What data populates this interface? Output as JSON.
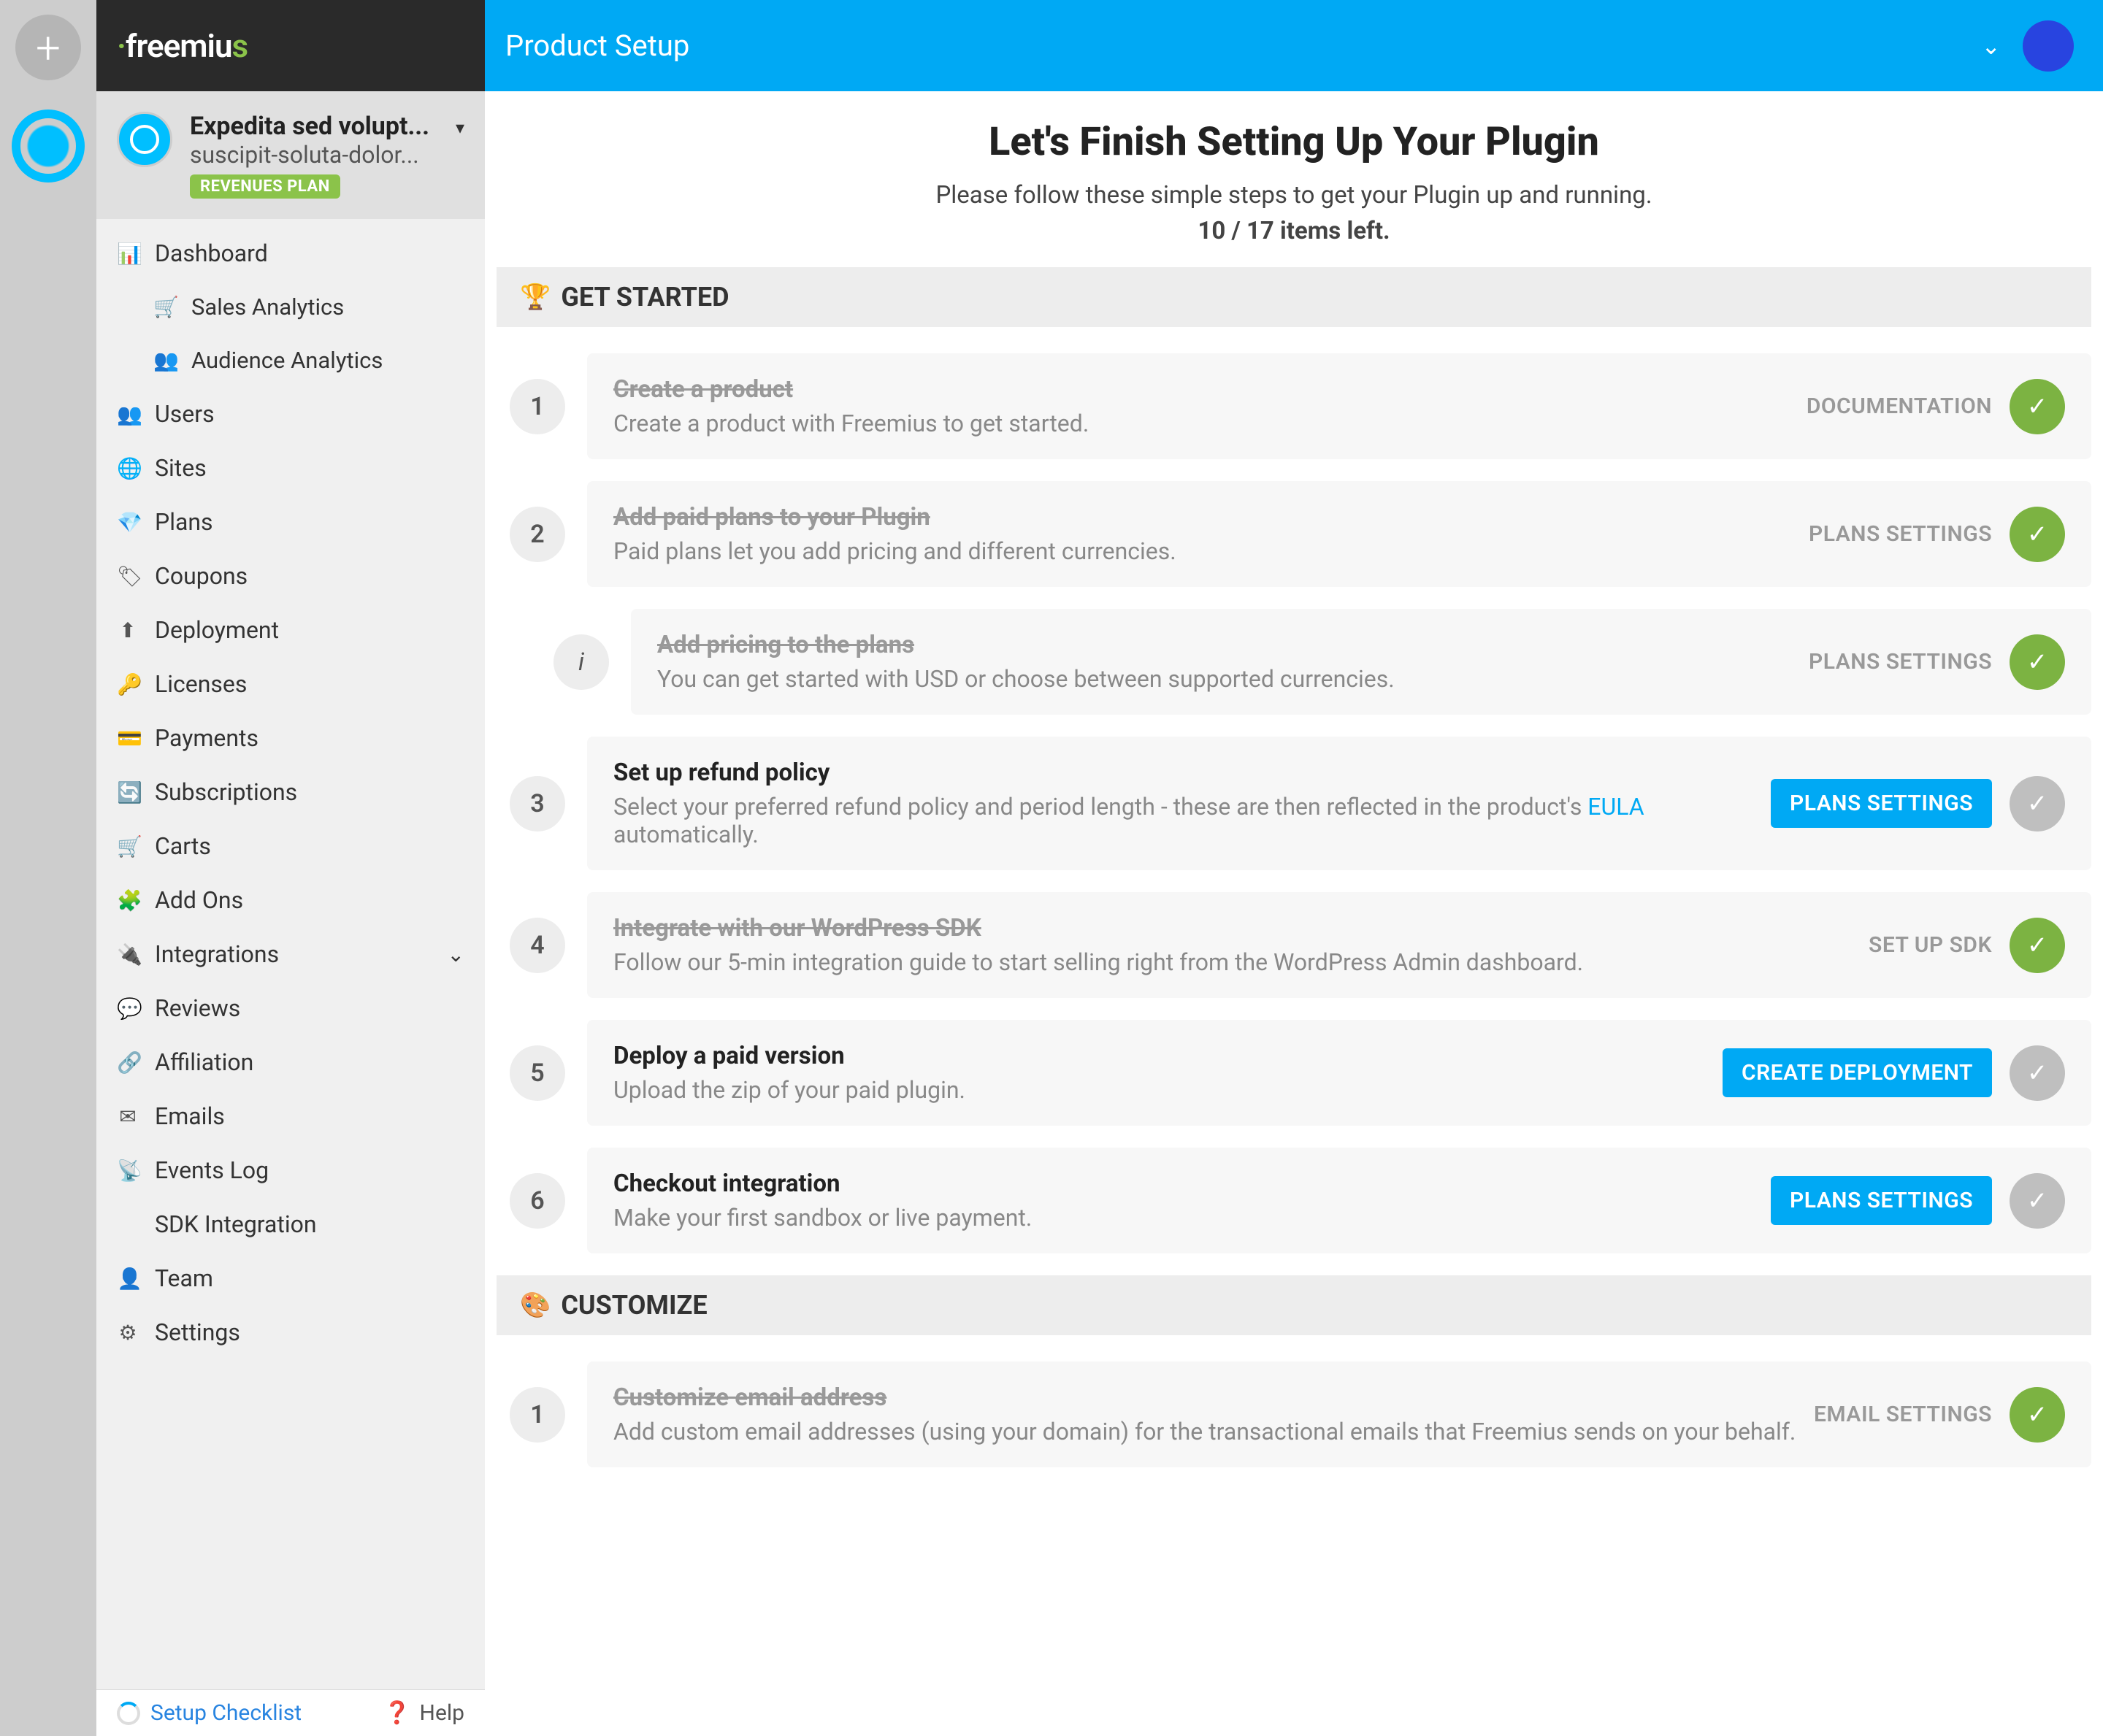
{
  "brand": {
    "name": "freemius"
  },
  "header": {
    "title": "Product Setup"
  },
  "product": {
    "title": "Expedita sed volupt...",
    "subtitle": "suscipit-soluta-dolor...",
    "badge": "REVENUES PLAN"
  },
  "nav": [
    {
      "label": "Dashboard",
      "icon": "📊",
      "name": "dashboard"
    },
    {
      "label": "Sales Analytics",
      "icon": "🛒",
      "name": "sales-analytics",
      "sub": true
    },
    {
      "label": "Audience Analytics",
      "icon": "👥",
      "name": "audience-analytics",
      "sub": true
    },
    {
      "label": "Users",
      "icon": "👥",
      "name": "users"
    },
    {
      "label": "Sites",
      "icon": "🌐",
      "name": "sites"
    },
    {
      "label": "Plans",
      "icon": "💎",
      "name": "plans"
    },
    {
      "label": "Coupons",
      "icon": "🏷",
      "name": "coupons"
    },
    {
      "label": "Deployment",
      "icon": "⬆",
      "name": "deployment"
    },
    {
      "label": "Licenses",
      "icon": "🔑",
      "name": "licenses"
    },
    {
      "label": "Payments",
      "icon": "💳",
      "name": "payments"
    },
    {
      "label": "Subscriptions",
      "icon": "🔄",
      "name": "subscriptions"
    },
    {
      "label": "Carts",
      "icon": "🛒",
      "name": "carts"
    },
    {
      "label": "Add Ons",
      "icon": "🧩",
      "name": "addons"
    },
    {
      "label": "Integrations",
      "icon": "🔌",
      "name": "integrations",
      "expand": true
    },
    {
      "label": "Reviews",
      "icon": "💬",
      "name": "reviews"
    },
    {
      "label": "Affiliation",
      "icon": "🔗",
      "name": "affiliation"
    },
    {
      "label": "Emails",
      "icon": "✉",
      "name": "emails"
    },
    {
      "label": "Events Log",
      "icon": "📡",
      "name": "events-log"
    },
    {
      "label": "SDK Integration",
      "icon": "</>",
      "name": "sdk-integration"
    },
    {
      "label": "Team",
      "icon": "👤",
      "name": "team"
    },
    {
      "label": "Settings",
      "icon": "⚙",
      "name": "settings"
    }
  ],
  "footer": {
    "setup": "Setup Checklist",
    "help": "Help"
  },
  "hero": {
    "title": "Let's Finish Setting Up Your Plugin",
    "subtitle": "Please follow these simple steps to get your Plugin up and running.",
    "progress": "10 / 17 items left."
  },
  "sections": {
    "get_started": {
      "label": "GET STARTED",
      "icon": "🏆"
    },
    "customize": {
      "label": "CUSTOMIZE",
      "icon": "🎨"
    }
  },
  "steps": [
    {
      "num": "1",
      "title": "Create a product",
      "desc": "Create a product with Freemius to get started.",
      "action": "DOCUMENTATION",
      "done": true,
      "button": false
    },
    {
      "num": "2",
      "title": "Add paid plans to your Plugin",
      "desc": "Paid plans let you add pricing and different currencies.",
      "action": "PLANS SETTINGS",
      "done": true,
      "button": false
    },
    {
      "num": "i",
      "title": "Add pricing to the plans",
      "desc": "You can get started with USD or choose between supported currencies.",
      "action": "PLANS SETTINGS",
      "done": true,
      "button": false,
      "indent": true
    },
    {
      "num": "3",
      "title": "Set up refund policy",
      "desc_pre": "Select your preferred refund policy and period length - these are then reflected in the product's ",
      "link": "EULA",
      "desc_post": " automatically.",
      "action": "PLANS SETTINGS",
      "done": false,
      "button": true
    },
    {
      "num": "4",
      "title": "Integrate with our WordPress SDK",
      "desc": "Follow our 5-min integration guide to start selling right from the WordPress Admin dashboard.",
      "action": "SET UP SDK",
      "done": true,
      "button": false
    },
    {
      "num": "5",
      "title": "Deploy a paid version",
      "desc": "Upload the zip of your paid plugin.",
      "action": "CREATE DEPLOYMENT",
      "done": false,
      "button": true
    },
    {
      "num": "6",
      "title": "Checkout integration",
      "desc": "Make your first sandbox or live payment.",
      "action": "PLANS SETTINGS",
      "done": false,
      "button": true
    }
  ],
  "customize_steps": [
    {
      "num": "1",
      "title": "Customize email address",
      "desc": "Add custom email addresses (using your domain) for the transactional emails that Freemius sends on your behalf.",
      "action": "EMAIL SETTINGS",
      "done": true,
      "button": false
    }
  ]
}
